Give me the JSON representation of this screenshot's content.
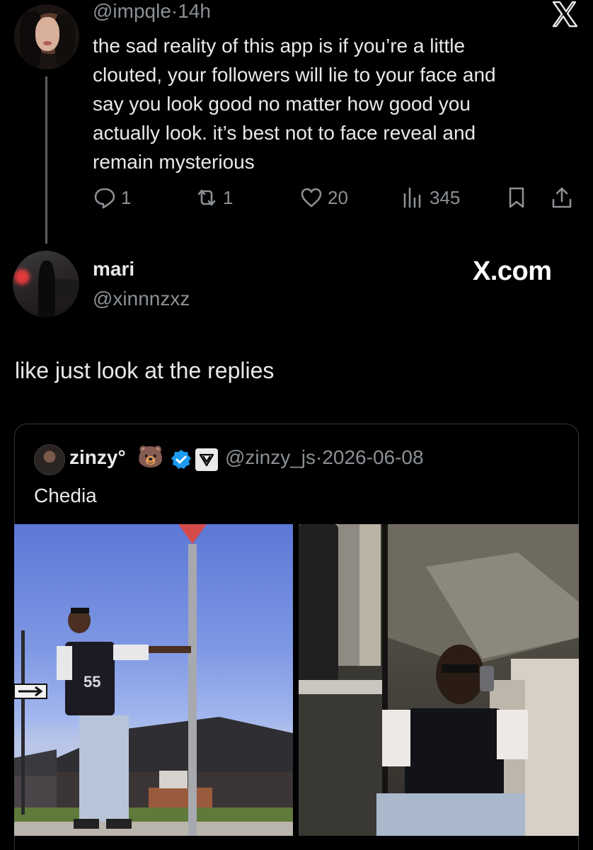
{
  "tweet": {
    "handle": "@impqle",
    "separator": "·",
    "time": "14h",
    "text": "the sad reality of this app is if you’re a little\nclouted, your followers will lie to your face and\nsay you look good no matter how good you\nactually look. it’s best not to face reveal and\nremain mysterious",
    "replies": "1",
    "reposts": "1",
    "likes": "20",
    "views": "345"
  },
  "reply": {
    "name": "mari",
    "handle": "@xinnnzxz",
    "text": "like just look at the replies"
  },
  "watermark": "X.com",
  "quoted": {
    "name": "zinzy°",
    "emoji": "🐻",
    "handle": "@zinzy_js",
    "separator": "·",
    "date": "2026-06-08",
    "text": "Chedia",
    "jersey_left": "55"
  },
  "colors": {
    "background": "#000000",
    "text": "#e7e9ea",
    "secondary": "#8b9095",
    "verified": "#1d9bf0",
    "border": "#333639"
  },
  "icons": [
    "x-logo-icon",
    "reply-icon",
    "repost-icon",
    "like-icon",
    "views-icon",
    "bookmark-icon",
    "share-icon",
    "verified-badge-icon",
    "affiliate-badge-icon"
  ]
}
